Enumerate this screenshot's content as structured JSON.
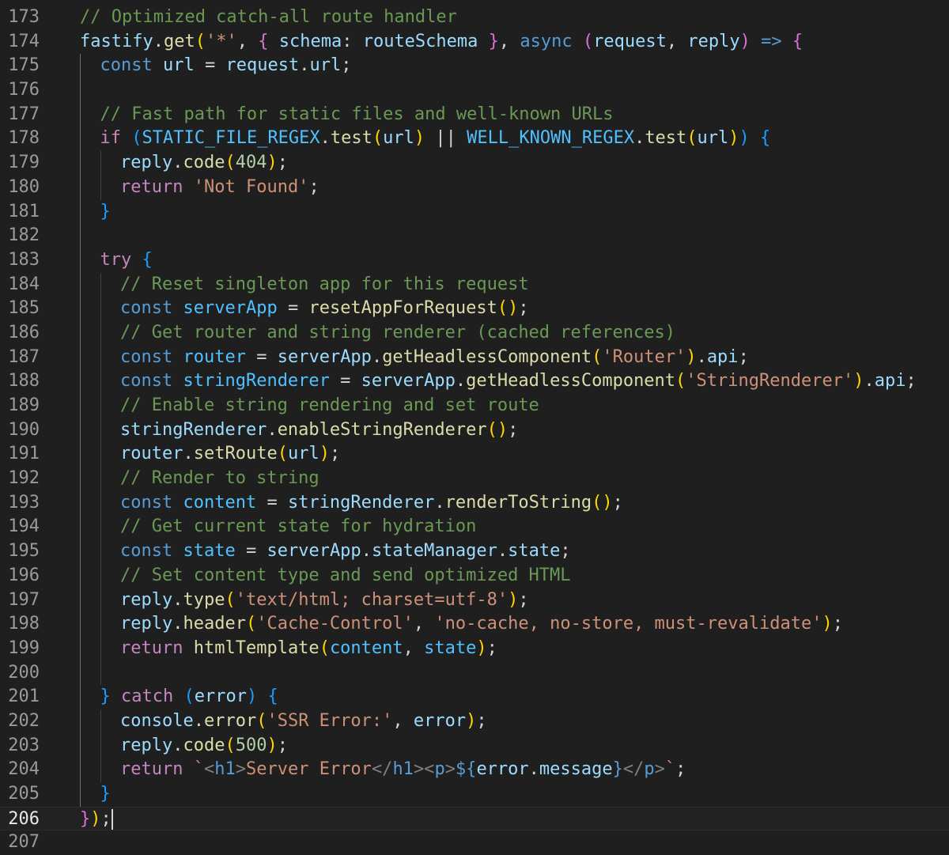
{
  "editor": {
    "current_line": 206,
    "lines": [
      {
        "n": "173",
        "indent": 0,
        "tokens": [
          [
            "com",
            "// Optimized catch-all route handler"
          ]
        ]
      },
      {
        "n": "174",
        "indent": 0,
        "tokens": [
          [
            "var",
            "fastify"
          ],
          [
            "op",
            "."
          ],
          [
            "fn",
            "get"
          ],
          [
            "b1",
            "("
          ],
          [
            "str",
            "'*'"
          ],
          [
            "op",
            ", "
          ],
          [
            "b2",
            "{"
          ],
          [
            "op",
            " "
          ],
          [
            "var",
            "schema"
          ],
          [
            "op",
            ": "
          ],
          [
            "var",
            "routeSchema"
          ],
          [
            "op",
            " "
          ],
          [
            "b2",
            "}"
          ],
          [
            "op",
            ", "
          ],
          [
            "kw",
            "async"
          ],
          [
            "op",
            " "
          ],
          [
            "b2",
            "("
          ],
          [
            "var",
            "request"
          ],
          [
            "op",
            ", "
          ],
          [
            "var",
            "reply"
          ],
          [
            "b2",
            ")"
          ],
          [
            "op",
            " "
          ],
          [
            "kw",
            "=>"
          ],
          [
            "op",
            " "
          ],
          [
            "b2",
            "{"
          ]
        ]
      },
      {
        "n": "175",
        "indent": 1,
        "tokens": [
          [
            "kw",
            "const"
          ],
          [
            "op",
            " "
          ],
          [
            "var",
            "url"
          ],
          [
            "op",
            " = "
          ],
          [
            "var",
            "request"
          ],
          [
            "op",
            "."
          ],
          [
            "var",
            "url"
          ],
          [
            "op",
            ";"
          ]
        ]
      },
      {
        "n": "176",
        "indent": 1,
        "tokens": []
      },
      {
        "n": "177",
        "indent": 1,
        "tokens": [
          [
            "com",
            "// Fast path for static files and well-known URLs"
          ]
        ]
      },
      {
        "n": "178",
        "indent": 1,
        "tokens": [
          [
            "ctl",
            "if"
          ],
          [
            "op",
            " "
          ],
          [
            "b3",
            "("
          ],
          [
            "const",
            "STATIC_FILE_REGEX"
          ],
          [
            "op",
            "."
          ],
          [
            "fn",
            "test"
          ],
          [
            "b1",
            "("
          ],
          [
            "var",
            "url"
          ],
          [
            "b1",
            ")"
          ],
          [
            "op",
            " || "
          ],
          [
            "const",
            "WELL_KNOWN_REGEX"
          ],
          [
            "op",
            "."
          ],
          [
            "fn",
            "test"
          ],
          [
            "b1",
            "("
          ],
          [
            "var",
            "url"
          ],
          [
            "b1",
            ")"
          ],
          [
            "b3",
            ")"
          ],
          [
            "op",
            " "
          ],
          [
            "b3",
            "{"
          ]
        ]
      },
      {
        "n": "179",
        "indent": 2,
        "tokens": [
          [
            "var",
            "reply"
          ],
          [
            "op",
            "."
          ],
          [
            "fn",
            "code"
          ],
          [
            "b1",
            "("
          ],
          [
            "num",
            "404"
          ],
          [
            "b1",
            ")"
          ],
          [
            "op",
            ";"
          ]
        ]
      },
      {
        "n": "180",
        "indent": 2,
        "tokens": [
          [
            "ctl",
            "return"
          ],
          [
            "op",
            " "
          ],
          [
            "str",
            "'Not Found'"
          ],
          [
            "op",
            ";"
          ]
        ]
      },
      {
        "n": "181",
        "indent": 1,
        "tokens": [
          [
            "b3",
            "}"
          ]
        ]
      },
      {
        "n": "182",
        "indent": 1,
        "tokens": []
      },
      {
        "n": "183",
        "indent": 1,
        "tokens": [
          [
            "ctl",
            "try"
          ],
          [
            "op",
            " "
          ],
          [
            "b3",
            "{"
          ]
        ]
      },
      {
        "n": "184",
        "indent": 2,
        "tokens": [
          [
            "com",
            "// Reset singleton app for this request"
          ]
        ]
      },
      {
        "n": "185",
        "indent": 2,
        "tokens": [
          [
            "kw",
            "const"
          ],
          [
            "op",
            " "
          ],
          [
            "const",
            "serverApp"
          ],
          [
            "op",
            " = "
          ],
          [
            "fn",
            "resetAppForRequest"
          ],
          [
            "b1",
            "()"
          ],
          [
            "op",
            ";"
          ]
        ]
      },
      {
        "n": "186",
        "indent": 2,
        "tokens": [
          [
            "com",
            "// Get router and string renderer (cached references)"
          ]
        ]
      },
      {
        "n": "187",
        "indent": 2,
        "tokens": [
          [
            "kw",
            "const"
          ],
          [
            "op",
            " "
          ],
          [
            "const",
            "router"
          ],
          [
            "op",
            " = "
          ],
          [
            "var",
            "serverApp"
          ],
          [
            "op",
            "."
          ],
          [
            "fn",
            "getHeadlessComponent"
          ],
          [
            "b1",
            "("
          ],
          [
            "str",
            "'Router'"
          ],
          [
            "b1",
            ")"
          ],
          [
            "op",
            "."
          ],
          [
            "var",
            "api"
          ],
          [
            "op",
            ";"
          ]
        ]
      },
      {
        "n": "188",
        "indent": 2,
        "tokens": [
          [
            "kw",
            "const"
          ],
          [
            "op",
            " "
          ],
          [
            "const",
            "stringRenderer"
          ],
          [
            "op",
            " = "
          ],
          [
            "var",
            "serverApp"
          ],
          [
            "op",
            "."
          ],
          [
            "fn",
            "getHeadlessComponent"
          ],
          [
            "b1",
            "("
          ],
          [
            "str",
            "'StringRenderer'"
          ],
          [
            "b1",
            ")"
          ],
          [
            "op",
            "."
          ],
          [
            "var",
            "api"
          ],
          [
            "op",
            ";"
          ]
        ]
      },
      {
        "n": "189",
        "indent": 2,
        "tokens": [
          [
            "com",
            "// Enable string rendering and set route"
          ]
        ]
      },
      {
        "n": "190",
        "indent": 2,
        "tokens": [
          [
            "var",
            "stringRenderer"
          ],
          [
            "op",
            "."
          ],
          [
            "fn",
            "enableStringRenderer"
          ],
          [
            "b1",
            "()"
          ],
          [
            "op",
            ";"
          ]
        ]
      },
      {
        "n": "191",
        "indent": 2,
        "tokens": [
          [
            "var",
            "router"
          ],
          [
            "op",
            "."
          ],
          [
            "fn",
            "setRoute"
          ],
          [
            "b1",
            "("
          ],
          [
            "var",
            "url"
          ],
          [
            "b1",
            ")"
          ],
          [
            "op",
            ";"
          ]
        ]
      },
      {
        "n": "192",
        "indent": 2,
        "tokens": [
          [
            "com",
            "// Render to string"
          ]
        ]
      },
      {
        "n": "193",
        "indent": 2,
        "tokens": [
          [
            "kw",
            "const"
          ],
          [
            "op",
            " "
          ],
          [
            "const",
            "content"
          ],
          [
            "op",
            " = "
          ],
          [
            "var",
            "stringRenderer"
          ],
          [
            "op",
            "."
          ],
          [
            "fn",
            "renderToString"
          ],
          [
            "b1",
            "()"
          ],
          [
            "op",
            ";"
          ]
        ]
      },
      {
        "n": "194",
        "indent": 2,
        "tokens": [
          [
            "com",
            "// Get current state for hydration"
          ]
        ]
      },
      {
        "n": "195",
        "indent": 2,
        "tokens": [
          [
            "kw",
            "const"
          ],
          [
            "op",
            " "
          ],
          [
            "const",
            "state"
          ],
          [
            "op",
            " = "
          ],
          [
            "var",
            "serverApp"
          ],
          [
            "op",
            "."
          ],
          [
            "var",
            "stateManager"
          ],
          [
            "op",
            "."
          ],
          [
            "var",
            "state"
          ],
          [
            "op",
            ";"
          ]
        ]
      },
      {
        "n": "196",
        "indent": 2,
        "tokens": [
          [
            "com",
            "// Set content type and send optimized HTML"
          ]
        ]
      },
      {
        "n": "197",
        "indent": 2,
        "tokens": [
          [
            "var",
            "reply"
          ],
          [
            "op",
            "."
          ],
          [
            "fn",
            "type"
          ],
          [
            "b1",
            "("
          ],
          [
            "str",
            "'text/html; charset=utf-8'"
          ],
          [
            "b1",
            ")"
          ],
          [
            "op",
            ";"
          ]
        ]
      },
      {
        "n": "198",
        "indent": 2,
        "tokens": [
          [
            "var",
            "reply"
          ],
          [
            "op",
            "."
          ],
          [
            "fn",
            "header"
          ],
          [
            "b1",
            "("
          ],
          [
            "str",
            "'Cache-Control'"
          ],
          [
            "op",
            ", "
          ],
          [
            "str",
            "'no-cache, no-store, must-revalidate'"
          ],
          [
            "b1",
            ")"
          ],
          [
            "op",
            ";"
          ]
        ]
      },
      {
        "n": "199",
        "indent": 2,
        "tokens": [
          [
            "ctl",
            "return"
          ],
          [
            "op",
            " "
          ],
          [
            "fn",
            "htmlTemplate"
          ],
          [
            "b1",
            "("
          ],
          [
            "const",
            "content"
          ],
          [
            "op",
            ", "
          ],
          [
            "const",
            "state"
          ],
          [
            "b1",
            ")"
          ],
          [
            "op",
            ";"
          ]
        ]
      },
      {
        "n": "200",
        "indent": 2,
        "tokens": []
      },
      {
        "n": "201",
        "indent": 1,
        "tokens": [
          [
            "b3",
            "}"
          ],
          [
            "op",
            " "
          ],
          [
            "ctl",
            "catch"
          ],
          [
            "op",
            " "
          ],
          [
            "b3",
            "("
          ],
          [
            "var",
            "error"
          ],
          [
            "b3",
            ")"
          ],
          [
            "op",
            " "
          ],
          [
            "b3",
            "{"
          ]
        ]
      },
      {
        "n": "202",
        "indent": 2,
        "tokens": [
          [
            "var",
            "console"
          ],
          [
            "op",
            "."
          ],
          [
            "fn",
            "error"
          ],
          [
            "b1",
            "("
          ],
          [
            "str",
            "'SSR Error:'"
          ],
          [
            "op",
            ", "
          ],
          [
            "var",
            "error"
          ],
          [
            "b1",
            ")"
          ],
          [
            "op",
            ";"
          ]
        ]
      },
      {
        "n": "203",
        "indent": 2,
        "tokens": [
          [
            "var",
            "reply"
          ],
          [
            "op",
            "."
          ],
          [
            "fn",
            "code"
          ],
          [
            "b1",
            "("
          ],
          [
            "num",
            "500"
          ],
          [
            "b1",
            ")"
          ],
          [
            "op",
            ";"
          ]
        ]
      },
      {
        "n": "204",
        "indent": 2,
        "tokens": [
          [
            "ctl",
            "return"
          ],
          [
            "op",
            " "
          ],
          [
            "str",
            "`"
          ],
          [
            "tag",
            "<"
          ],
          [
            "tn",
            "h1"
          ],
          [
            "tag",
            ">"
          ],
          [
            "str",
            "Server Error"
          ],
          [
            "tag",
            "</"
          ],
          [
            "tn",
            "h1"
          ],
          [
            "tag",
            "><"
          ],
          [
            "tn",
            "p"
          ],
          [
            "tag",
            ">"
          ],
          [
            "tmpl",
            "${"
          ],
          [
            "var",
            "error"
          ],
          [
            "op",
            "."
          ],
          [
            "var",
            "message"
          ],
          [
            "tmpl",
            "}"
          ],
          [
            "tag",
            "</"
          ],
          [
            "tn",
            "p"
          ],
          [
            "tag",
            ">"
          ],
          [
            "str",
            "`"
          ],
          [
            "op",
            ";"
          ]
        ]
      },
      {
        "n": "205",
        "indent": 1,
        "tokens": [
          [
            "b3",
            "}"
          ]
        ]
      },
      {
        "n": "206",
        "indent": 0,
        "tokens": [
          [
            "b2",
            "}"
          ],
          [
            "b1",
            ")"
          ],
          [
            "op",
            ";"
          ]
        ],
        "cursor": true
      },
      {
        "n": "207",
        "indent": 0,
        "tokens": []
      }
    ]
  },
  "colors": {
    "background": "#1f1f1f",
    "comment": "#6a9955",
    "keyword": "#569cd6",
    "control": "#c586c0",
    "variable": "#9cdcfe",
    "constant": "#4fc1ff",
    "function": "#dcdcaa",
    "string": "#ce9178",
    "number": "#b5cea8"
  }
}
